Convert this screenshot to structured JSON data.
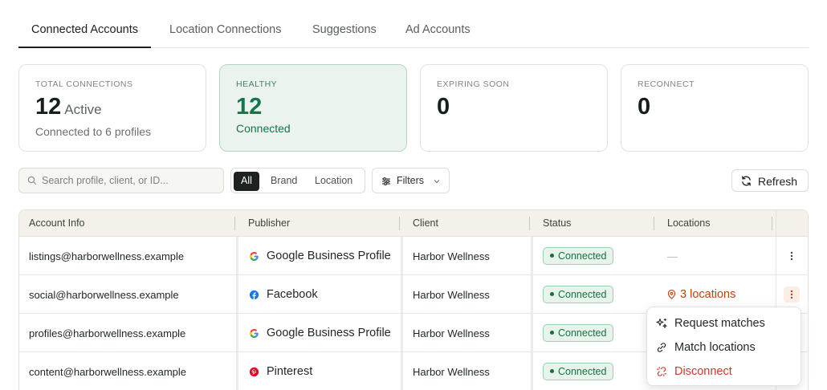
{
  "tabs": [
    {
      "label": "Connected Accounts",
      "active": true
    },
    {
      "label": "Location Connections",
      "active": false
    },
    {
      "label": "Suggestions",
      "active": false
    },
    {
      "label": "Ad Accounts",
      "active": false
    }
  ],
  "stats": {
    "total": {
      "label": "TOTAL CONNECTIONS",
      "value": "12",
      "suffix": "Active",
      "sub": "Connected to 6 profiles"
    },
    "healthy": {
      "label": "HEALTHY",
      "value": "12",
      "sub": "Connected"
    },
    "expiring": {
      "label": "EXPIRING SOON",
      "value": "0"
    },
    "reconnect": {
      "label": "RECONNECT",
      "value": "0"
    }
  },
  "toolbar": {
    "search_placeholder": "Search profile, client, or ID...",
    "segments": [
      "All",
      "Brand",
      "Location"
    ],
    "active_segment": "All",
    "filters_label": "Filters",
    "refresh_label": "Refresh"
  },
  "table": {
    "headers": [
      "Account Info",
      "Publisher",
      "Client",
      "Status",
      "Locations"
    ],
    "rows": [
      {
        "account": "listings@harborwellness.example",
        "publisher": "Google Business Profile",
        "publisher_icon": "google-icon",
        "client": "Harbor Wellness",
        "status": "Connected",
        "locations": "—"
      },
      {
        "account": "social@harborwellness.example",
        "publisher": "Facebook",
        "publisher_icon": "facebook-icon",
        "client": "Harbor Wellness",
        "status": "Connected",
        "locations": "3 locations"
      },
      {
        "account": "profiles@harborwellness.example",
        "publisher": "Google Business Profile",
        "publisher_icon": "google-icon",
        "client": "Harbor Wellness",
        "status": "Connected",
        "locations": ""
      },
      {
        "account": "content@harborwellness.example",
        "publisher": "Pinterest",
        "publisher_icon": "pinterest-icon",
        "client": "Harbor Wellness",
        "status": "Connected",
        "locations": ""
      }
    ]
  },
  "row_menu": {
    "items": [
      {
        "label": "Request matches",
        "icon": "sparkle-icon"
      },
      {
        "label": "Match locations",
        "icon": "link-icon"
      },
      {
        "label": "Disconnect",
        "icon": "unlink-icon",
        "danger": true
      }
    ]
  },
  "colors": {
    "accent_green": "#15744a",
    "healthy_bg": "#eaf3ee",
    "danger": "#c43c2c",
    "locations_link": "#c2410c"
  }
}
